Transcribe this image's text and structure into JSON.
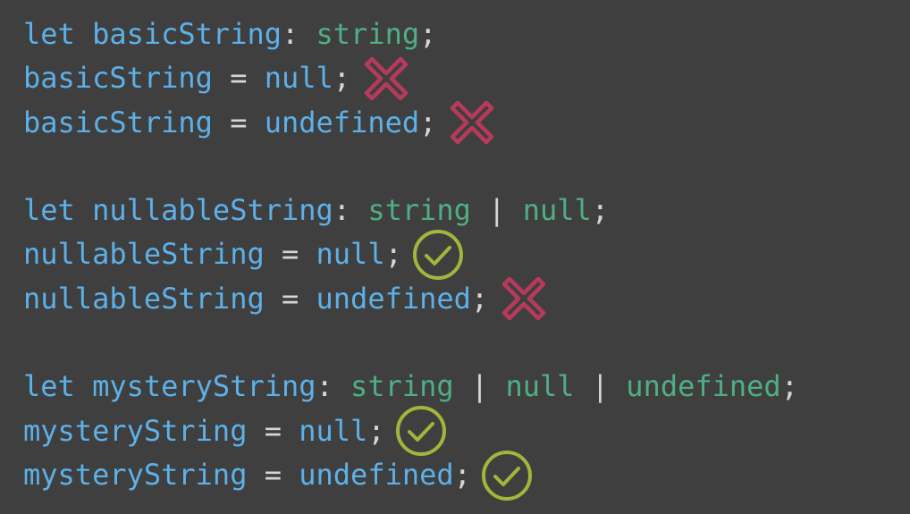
{
  "colors": {
    "background": "#3f3f3f",
    "keyword": "#5db0e8",
    "identifier": "#b9d7ea",
    "type": "#4fae84",
    "operator": "#d6d6d6",
    "value": "#5db0e8",
    "cross": "#b73a5c",
    "check": "#a3b53a"
  },
  "lines": [
    {
      "tokens": [
        {
          "text": "let ",
          "kind": "keyword"
        },
        {
          "text": "basicString",
          "kind": "keyword"
        },
        {
          "text": ": ",
          "kind": "operator"
        },
        {
          "text": "string",
          "kind": "type"
        },
        {
          "text": ";",
          "kind": "operator"
        }
      ],
      "mark": ""
    },
    {
      "tokens": [
        {
          "text": "basicString",
          "kind": "keyword"
        },
        {
          "text": " = ",
          "kind": "operator"
        },
        {
          "text": "null",
          "kind": "value"
        },
        {
          "text": ";",
          "kind": "operator"
        }
      ],
      "mark": "cross"
    },
    {
      "tokens": [
        {
          "text": "basicString",
          "kind": "keyword"
        },
        {
          "text": " = ",
          "kind": "operator"
        },
        {
          "text": "undefined",
          "kind": "value"
        },
        {
          "text": ";",
          "kind": "operator"
        }
      ],
      "mark": "cross"
    },
    {
      "tokens": [],
      "mark": ""
    },
    {
      "tokens": [
        {
          "text": "let ",
          "kind": "keyword"
        },
        {
          "text": "nullableString",
          "kind": "keyword"
        },
        {
          "text": ": ",
          "kind": "operator"
        },
        {
          "text": "string",
          "kind": "type"
        },
        {
          "text": " | ",
          "kind": "operator"
        },
        {
          "text": "null",
          "kind": "type"
        },
        {
          "text": ";",
          "kind": "operator"
        }
      ],
      "mark": ""
    },
    {
      "tokens": [
        {
          "text": "nullableString",
          "kind": "keyword"
        },
        {
          "text": " = ",
          "kind": "operator"
        },
        {
          "text": "null",
          "kind": "value"
        },
        {
          "text": ";",
          "kind": "operator"
        }
      ],
      "mark": "check"
    },
    {
      "tokens": [
        {
          "text": "nullableString",
          "kind": "keyword"
        },
        {
          "text": " = ",
          "kind": "operator"
        },
        {
          "text": "undefined",
          "kind": "value"
        },
        {
          "text": ";",
          "kind": "operator"
        }
      ],
      "mark": "cross"
    },
    {
      "tokens": [],
      "mark": ""
    },
    {
      "tokens": [
        {
          "text": "let ",
          "kind": "keyword"
        },
        {
          "text": "mysteryString",
          "kind": "keyword"
        },
        {
          "text": ": ",
          "kind": "operator"
        },
        {
          "text": "string",
          "kind": "type"
        },
        {
          "text": " | ",
          "kind": "operator"
        },
        {
          "text": "null",
          "kind": "type"
        },
        {
          "text": " | ",
          "kind": "operator"
        },
        {
          "text": "undefined",
          "kind": "type"
        },
        {
          "text": ";",
          "kind": "operator"
        }
      ],
      "mark": ""
    },
    {
      "tokens": [
        {
          "text": "mysteryString",
          "kind": "keyword"
        },
        {
          "text": " = ",
          "kind": "operator"
        },
        {
          "text": "null",
          "kind": "value"
        },
        {
          "text": ";",
          "kind": "operator"
        }
      ],
      "mark": "check"
    },
    {
      "tokens": [
        {
          "text": "mysteryString",
          "kind": "keyword"
        },
        {
          "text": " = ",
          "kind": "operator"
        },
        {
          "text": "undefined",
          "kind": "value"
        },
        {
          "text": ";",
          "kind": "operator"
        }
      ],
      "mark": "check"
    }
  ],
  "icons": {
    "cross": "cross-icon",
    "check": "check-circle-icon"
  }
}
